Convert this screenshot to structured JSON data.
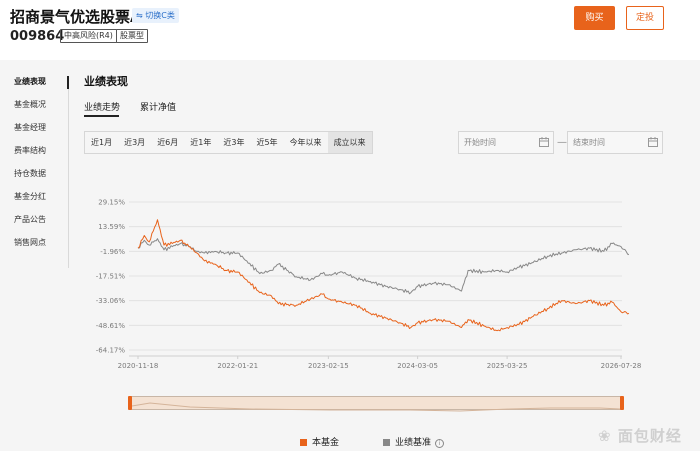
{
  "header": {
    "fund_name": "招商景气优选股票A",
    "switch_label": "切换C类",
    "fund_code": "009864",
    "tags": [
      "中高风险(R4)",
      "股票型"
    ],
    "buy_label": "购买",
    "fixed_invest_label": "定投"
  },
  "sidebar": {
    "items": [
      {
        "label": "业绩表现"
      },
      {
        "label": "基金概况"
      },
      {
        "label": "基金经理"
      },
      {
        "label": "费率结构"
      },
      {
        "label": "持仓数据"
      },
      {
        "label": "基金分红"
      },
      {
        "label": "产品公告"
      },
      {
        "label": "销售网点"
      }
    ]
  },
  "main": {
    "title": "业绩表现",
    "tabs": [
      {
        "label": "业绩走势"
      },
      {
        "label": "累计净值"
      }
    ],
    "ranges": [
      {
        "label": "近1月"
      },
      {
        "label": "近3月"
      },
      {
        "label": "近6月"
      },
      {
        "label": "近1年"
      },
      {
        "label": "近3年"
      },
      {
        "label": "近5年"
      },
      {
        "label": "今年以来"
      },
      {
        "label": "成立以来"
      }
    ],
    "start_date_placeholder": "开始时间",
    "end_date_placeholder": "结束时间",
    "date_separator": "—"
  },
  "chart_data": {
    "type": "line",
    "y_tick_labels": [
      "29.15%",
      "13.59%",
      "-1.96%",
      "-17.51%",
      "-33.06%",
      "-48.61%",
      "-64.17%"
    ],
    "x_tick_labels": [
      "2020-11-18",
      "2022-01-21",
      "2023-02-15",
      "2024-03-05",
      "2025-03-25",
      "2026-07-28"
    ],
    "ylim": [
      -64.17,
      29.15
    ],
    "grid": "horizontal",
    "legend_position": "bottom",
    "series": [
      {
        "name": "本基金",
        "color": "#e8631b",
        "points": [
          [
            "2020-11-18",
            0.0
          ],
          [
            "2020-12-15",
            8.0
          ],
          [
            "2021-01-05",
            4.0
          ],
          [
            "2021-02-10",
            18.0
          ],
          [
            "2021-03-10",
            2.0
          ],
          [
            "2021-04-15",
            3.0
          ],
          [
            "2021-05-20",
            5.0
          ],
          [
            "2021-06-25",
            1.0
          ],
          [
            "2021-07-30",
            -3.0
          ],
          [
            "2021-08-31",
            -8.0
          ],
          [
            "2021-10-15",
            -10.0
          ],
          [
            "2021-11-30",
            -14.0
          ],
          [
            "2022-01-21",
            -15.0
          ],
          [
            "2022-03-01",
            -20.0
          ],
          [
            "2022-04-26",
            -28.0
          ],
          [
            "2022-06-15",
            -30.0
          ],
          [
            "2022-07-15",
            -35.0
          ],
          [
            "2022-09-30",
            -36.0
          ],
          [
            "2022-11-30",
            -32.0
          ],
          [
            "2023-01-20",
            -29.0
          ],
          [
            "2023-02-15",
            -32.0
          ],
          [
            "2023-04-15",
            -34.0
          ],
          [
            "2023-06-15",
            -36.0
          ],
          [
            "2023-08-15",
            -41.0
          ],
          [
            "2023-10-20",
            -44.0
          ],
          [
            "2023-12-20",
            -47.0
          ],
          [
            "2024-02-05",
            -50.0
          ],
          [
            "2024-03-05",
            -47.0
          ],
          [
            "2024-05-15",
            -45.0
          ],
          [
            "2024-07-15",
            -46.0
          ],
          [
            "2024-09-10",
            -50.0
          ],
          [
            "2024-10-08",
            -45.0
          ],
          [
            "2024-12-15",
            -49.0
          ],
          [
            "2025-02-10",
            -52.0
          ],
          [
            "2025-03-25",
            -50.0
          ],
          [
            "2025-05-15",
            -48.0
          ],
          [
            "2025-07-15",
            -43.0
          ],
          [
            "2025-09-15",
            -38.0
          ],
          [
            "2025-11-15",
            -33.0
          ],
          [
            "2026-01-15",
            -35.0
          ],
          [
            "2026-03-15",
            -33.0
          ],
          [
            "2026-05-15",
            -36.0
          ],
          [
            "2026-06-20",
            -34.0
          ],
          [
            "2026-07-28",
            -40.0
          ],
          [
            "2026-08-31",
            -41.0
          ]
        ]
      },
      {
        "name": "业绩基准",
        "color": "#888888",
        "points": [
          [
            "2020-11-18",
            0.0
          ],
          [
            "2020-12-15",
            5.0
          ],
          [
            "2021-01-05",
            2.0
          ],
          [
            "2021-02-10",
            6.0
          ],
          [
            "2021-03-10",
            -1.0
          ],
          [
            "2021-04-15",
            1.0
          ],
          [
            "2021-05-20",
            3.0
          ],
          [
            "2021-06-25",
            1.0
          ],
          [
            "2021-07-30",
            -2.0
          ],
          [
            "2021-08-31",
            -3.0
          ],
          [
            "2021-10-15",
            -2.0
          ],
          [
            "2021-11-30",
            -3.0
          ],
          [
            "2022-01-21",
            -3.0
          ],
          [
            "2022-03-01",
            -8.0
          ],
          [
            "2022-04-26",
            -16.0
          ],
          [
            "2022-06-15",
            -14.0
          ],
          [
            "2022-07-15",
            -10.0
          ],
          [
            "2022-09-30",
            -18.0
          ],
          [
            "2022-11-30",
            -20.0
          ],
          [
            "2023-01-20",
            -16.0
          ],
          [
            "2023-02-15",
            -17.0
          ],
          [
            "2023-04-15",
            -15.0
          ],
          [
            "2023-06-15",
            -19.0
          ],
          [
            "2023-08-15",
            -21.0
          ],
          [
            "2023-10-20",
            -24.0
          ],
          [
            "2023-12-20",
            -26.0
          ],
          [
            "2024-02-05",
            -28.0
          ],
          [
            "2024-03-05",
            -24.0
          ],
          [
            "2024-05-15",
            -22.0
          ],
          [
            "2024-07-15",
            -23.0
          ],
          [
            "2024-09-10",
            -27.0
          ],
          [
            "2024-10-08",
            -14.0
          ],
          [
            "2024-12-15",
            -15.0
          ],
          [
            "2025-02-10",
            -14.0
          ],
          [
            "2025-03-25",
            -15.0
          ],
          [
            "2025-05-15",
            -12.0
          ],
          [
            "2025-07-15",
            -9.0
          ],
          [
            "2025-09-15",
            -5.0
          ],
          [
            "2025-11-15",
            -3.0
          ],
          [
            "2026-01-15",
            -1.0
          ],
          [
            "2026-03-15",
            0.0
          ],
          [
            "2026-05-15",
            -2.0
          ],
          [
            "2026-06-20",
            3.0
          ],
          [
            "2026-07-28",
            1.0
          ],
          [
            "2026-08-31",
            -4.0
          ]
        ]
      }
    ]
  },
  "legend": {
    "items": [
      {
        "label": "本基金",
        "color": "#e8631b"
      },
      {
        "label": "业绩基准",
        "color": "#888888"
      }
    ]
  },
  "watermark": "面包财经"
}
